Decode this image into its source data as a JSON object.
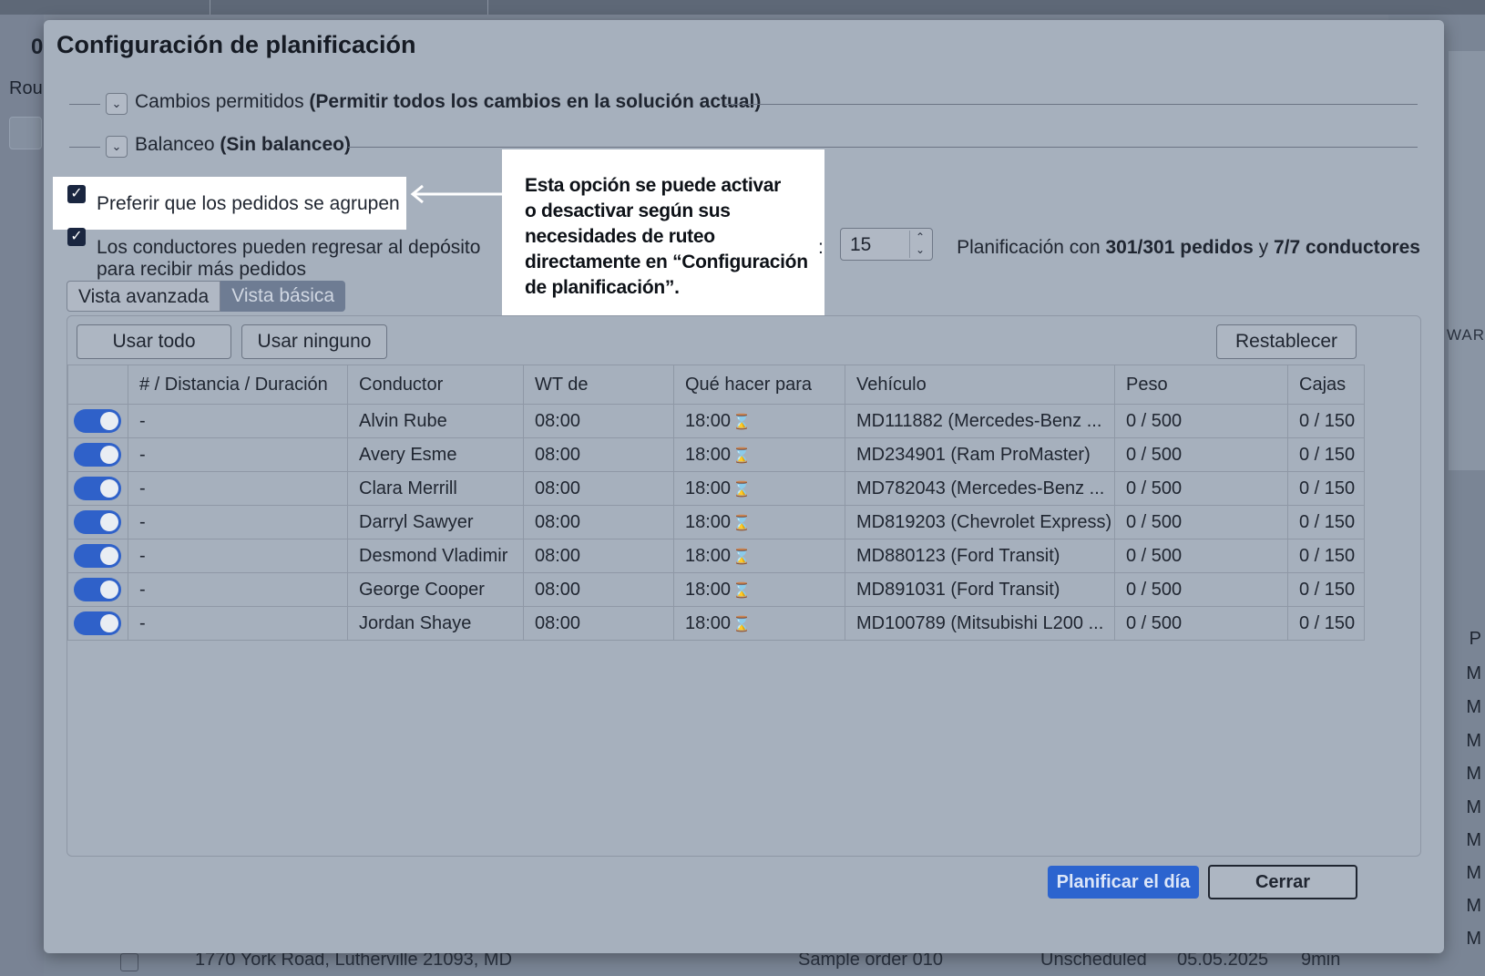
{
  "background": {
    "left_count": "0",
    "left_label": "Rou",
    "map_label": "WAR",
    "bottom_row": {
      "address": "1770 York Road, Lutherville 21093, MD",
      "order": "Sample order 010",
      "status": "Unscheduled",
      "date": "05.05.2025",
      "duration": "9min"
    },
    "right_column_header": "P",
    "right_column_cells": [
      "M",
      "M",
      "M",
      "M",
      "M",
      "M",
      "M",
      "M",
      "M"
    ]
  },
  "modal": {
    "title": "Configuración de planificación",
    "sections": [
      {
        "label": "Cambios permitidos",
        "value": "(Permitir todos los cambios en la solución actual)"
      },
      {
        "label": "Balanceo",
        "value": "(Sin balanceo)"
      }
    ],
    "options": {
      "group_orders": "Preferir que los pedidos se agrupen",
      "return_depot_line1": "Los conductores pueden regresar al depósito",
      "return_depot_line2": "para recibir más pedidos"
    },
    "tooltip": {
      "line1": "Esta opción se puede activar",
      "line2": "o desactivar según sus",
      "line3": "necesidades de ruteo",
      "line4": "directamente en “Configuración",
      "line5": "de planificación”."
    },
    "stepper": {
      "colon": ":",
      "value": "15"
    },
    "summary": {
      "prefix": "Planificación con",
      "orders": "301/301 pedidos",
      "conj": "y",
      "drivers": "7/7 conductores"
    },
    "view_toggle": {
      "advanced": "Vista avanzada",
      "basic": "Vista básica"
    },
    "buttons": {
      "use_all": "Usar todo",
      "use_none": "Usar ninguno",
      "reset": "Restablecer",
      "plan_day": "Planificar el día",
      "close": "Cerrar"
    },
    "table": {
      "headers": [
        "# / Distancia / Duración",
        "Conductor",
        "WT de",
        "Qué hacer para",
        "Vehículo",
        "Peso",
        "Cajas"
      ],
      "rows": [
        {
          "dist": "-",
          "driver": "Alvin Rube",
          "wt_from": "08:00",
          "to": "18:00",
          "vehicle": "MD111882 (Mercedes-Benz ...",
          "weight": "0 / 500",
          "boxes": "0 / 150",
          "enabled": true
        },
        {
          "dist": "-",
          "driver": "Avery Esme",
          "wt_from": "08:00",
          "to": "18:00",
          "vehicle": "MD234901 (Ram ProMaster)",
          "weight": "0 / 500",
          "boxes": "0 / 150",
          "enabled": true
        },
        {
          "dist": "-",
          "driver": "Clara Merrill",
          "wt_from": "08:00",
          "to": "18:00",
          "vehicle": "MD782043 (Mercedes-Benz ...",
          "weight": "0 / 500",
          "boxes": "0 / 150",
          "enabled": true
        },
        {
          "dist": "-",
          "driver": "Darryl Sawyer",
          "wt_from": "08:00",
          "to": "18:00",
          "vehicle": "MD819203 (Chevrolet Express)",
          "weight": "0 / 500",
          "boxes": "0 / 150",
          "enabled": true
        },
        {
          "dist": "-",
          "driver": "Desmond Vladimir",
          "wt_from": "08:00",
          "to": "18:00",
          "vehicle": "MD880123 (Ford Transit)",
          "weight": "0 / 500",
          "boxes": "0 / 150",
          "enabled": true
        },
        {
          "dist": "-",
          "driver": "George Cooper",
          "wt_from": "08:00",
          "to": "18:00",
          "vehicle": "MD891031 (Ford Transit)",
          "weight": "0 / 500",
          "boxes": "0 / 150",
          "enabled": true
        },
        {
          "dist": "-",
          "driver": "Jordan Shaye",
          "wt_from": "08:00",
          "to": "18:00",
          "vehicle": "MD100789 (Mitsubishi L200 ...",
          "weight": "0 / 500",
          "boxes": "0 / 150",
          "enabled": true
        }
      ]
    }
  },
  "colors": {
    "accent": "#2c64cf",
    "toggle_on": "#2f61c9",
    "checkbox": "#1a2640",
    "modal_bg": "#a6b0bd",
    "tooltip_bg": "#ffffff"
  },
  "icons": [
    "chevron-down-icon",
    "checkbox-checked-icon",
    "arrow-left-icon",
    "hourglass-icon",
    "stepper-arrows-icon",
    "copy-icon"
  ]
}
